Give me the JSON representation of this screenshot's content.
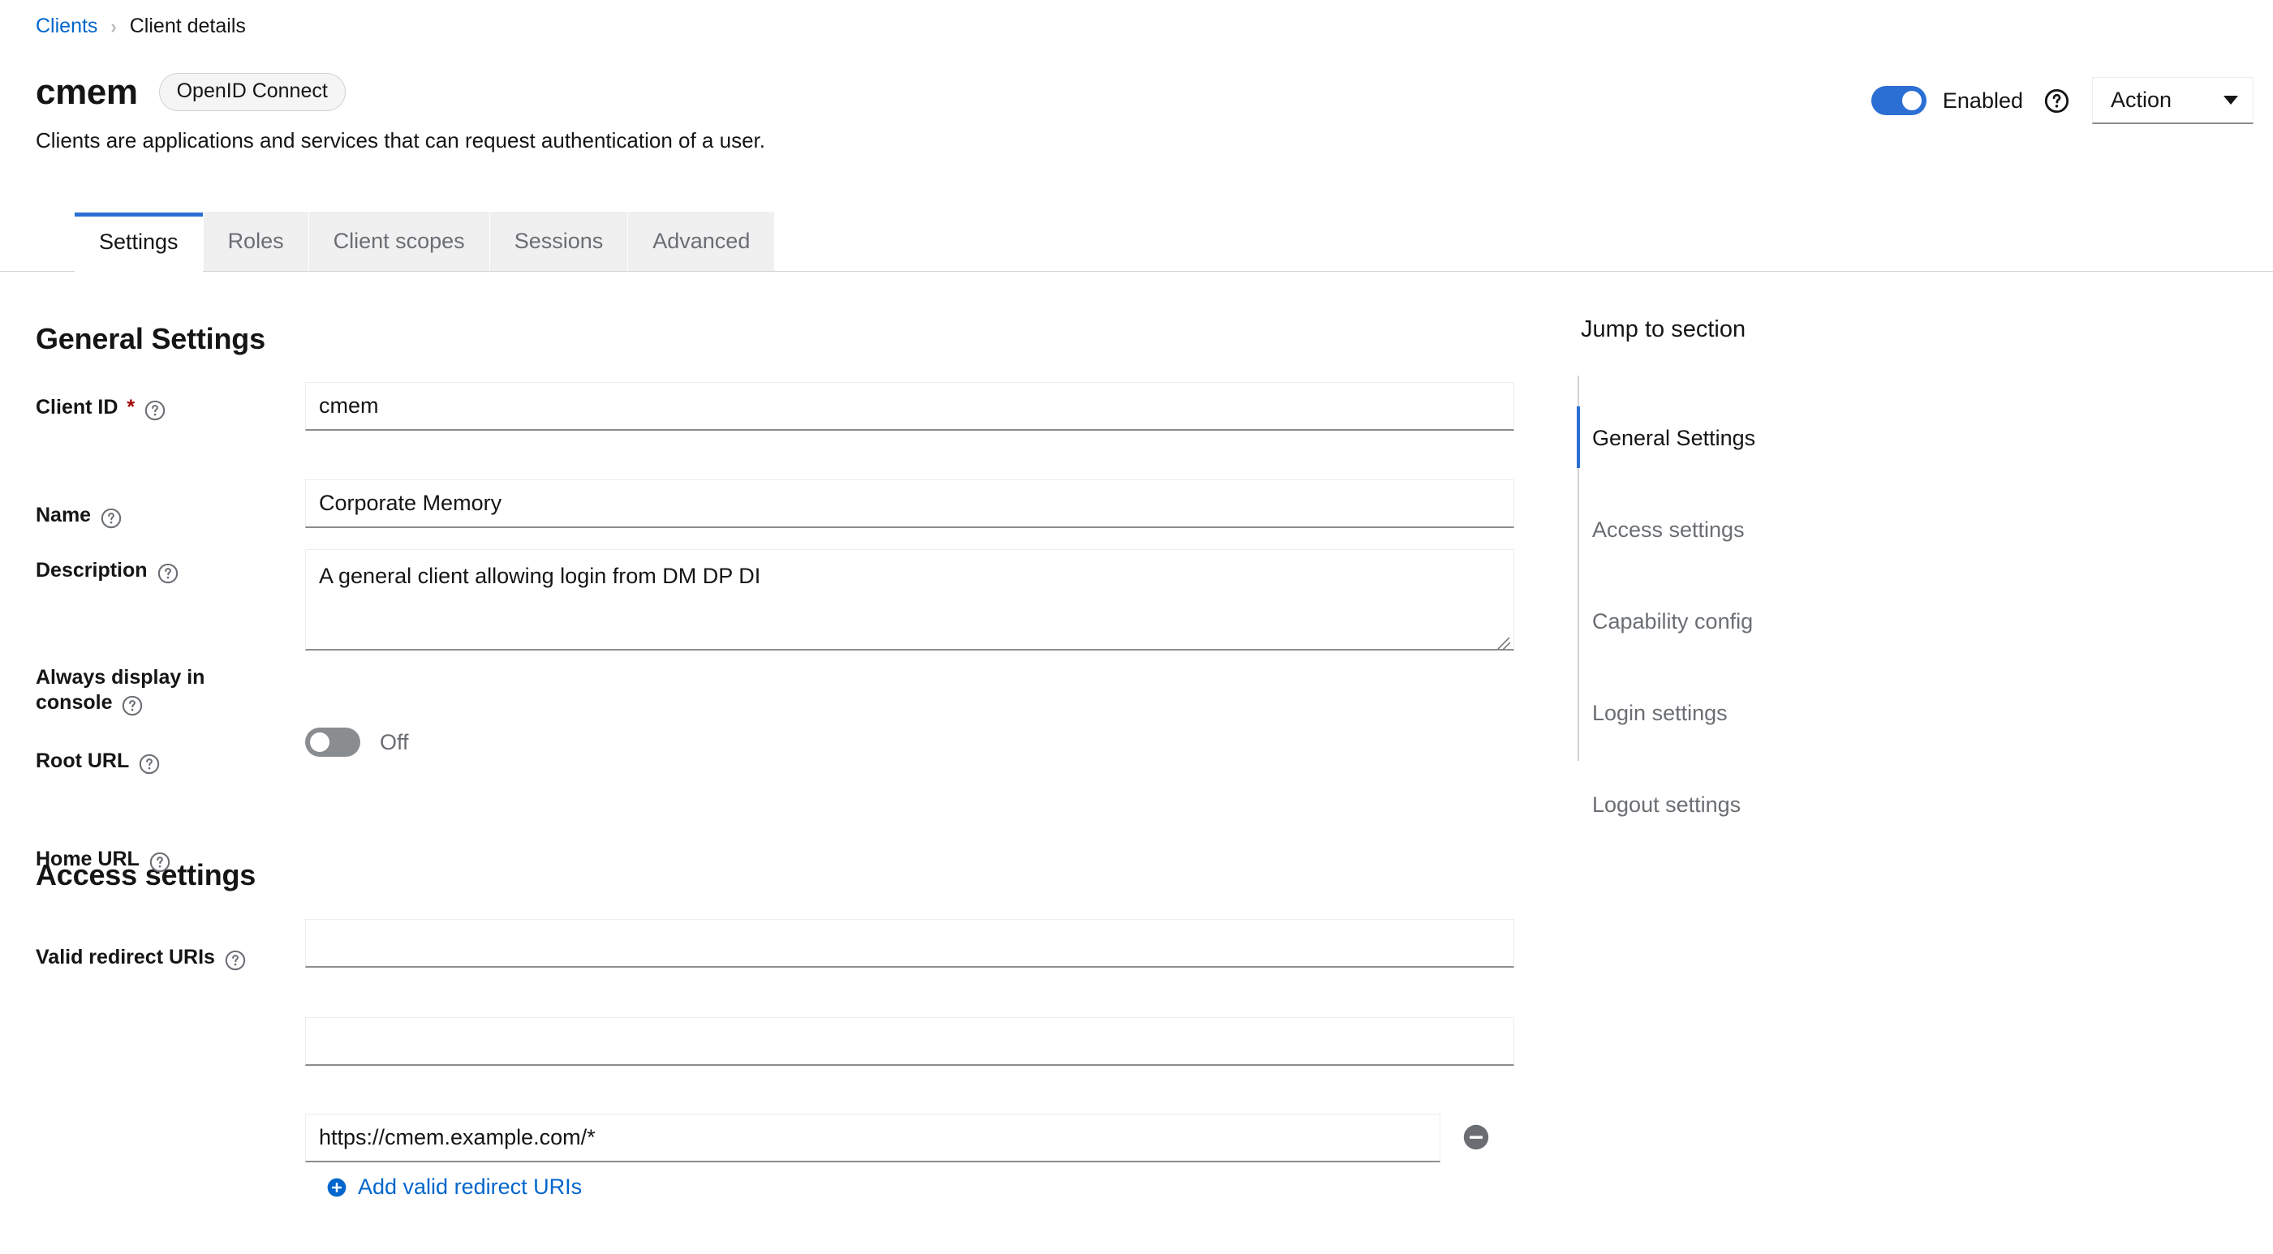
{
  "breadcrumb": {
    "parent": "Clients",
    "separator": "›",
    "current": "Client details"
  },
  "header": {
    "title": "cmem",
    "badge": "OpenID Connect",
    "subtitle": "Clients are applications and services that can request authentication of a user.",
    "enabled_label": "Enabled",
    "enabled_state": true,
    "help_icon": "help-circle-icon",
    "action_label": "Action",
    "caret_icon": "chevron-down-icon"
  },
  "tabs": [
    {
      "label": "Settings",
      "active": true
    },
    {
      "label": "Roles",
      "active": false
    },
    {
      "label": "Client scopes",
      "active": false
    },
    {
      "label": "Sessions",
      "active": false
    },
    {
      "label": "Advanced",
      "active": false
    }
  ],
  "general_settings": {
    "heading": "General Settings",
    "fields": {
      "client_id": {
        "label": "Client ID",
        "required_marker": "*",
        "value": "cmem",
        "placeholder": ""
      },
      "name": {
        "label": "Name",
        "value": "Corporate Memory",
        "placeholder": ""
      },
      "description": {
        "label": "Description",
        "value": "A general client allowing login from DM DP DI",
        "placeholder": ""
      },
      "always_display": {
        "label_line1": "Always display in",
        "label_line2": "console",
        "state_label": "Off",
        "state": false
      }
    }
  },
  "access_settings": {
    "heading": "Access settings",
    "fields": {
      "root_url": {
        "label": "Root URL",
        "value": "",
        "placeholder": ""
      },
      "home_url": {
        "label": "Home URL",
        "value": "",
        "placeholder": ""
      },
      "valid_redirect_uris": {
        "label": "Valid redirect URIs",
        "value": "https://cmem.example.com/*",
        "placeholder": "",
        "remove_icon": "minus-circle-icon",
        "add_label": "Add valid redirect URIs",
        "add_icon": "plus-circle-icon"
      }
    }
  },
  "jump_to_section": {
    "title": "Jump to section",
    "items": [
      {
        "label": "General Settings",
        "active": true
      },
      {
        "label": "Access settings",
        "active": false
      },
      {
        "label": "Capability config",
        "active": false
      },
      {
        "label": "Login settings",
        "active": false
      },
      {
        "label": "Logout settings",
        "active": false
      }
    ]
  },
  "colors": {
    "link": "#0066cc",
    "accent": "#2b6fd4",
    "required": "#a30000",
    "muted": "#6a6e73",
    "tab_inactive_bg": "#f0f0f0",
    "border": "#d2d2d2"
  }
}
